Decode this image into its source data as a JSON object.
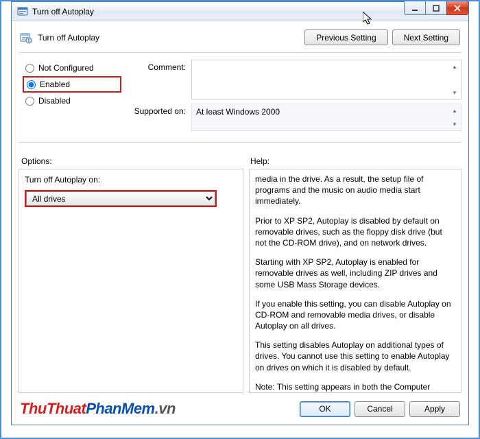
{
  "window": {
    "title": "Turn off Autoplay",
    "policy_title": "Turn off Autoplay"
  },
  "nav": {
    "prev": "Previous Setting",
    "next": "Next Setting"
  },
  "state": {
    "not_configured": "Not Configured",
    "enabled": "Enabled",
    "disabled": "Disabled",
    "selected": "enabled"
  },
  "meta": {
    "comment_label": "Comment:",
    "comment_value": "",
    "supported_label": "Supported on:",
    "supported_value": "At least Windows 2000"
  },
  "labels": {
    "options": "Options:",
    "help": "Help:"
  },
  "options_pane": {
    "field_label": "Turn off Autoplay on:",
    "selected_value": "All drives"
  },
  "help": {
    "p1": "media in the drive. As a result, the setup file of programs and the music on audio media start immediately.",
    "p2": "Prior to XP SP2, Autoplay is disabled by default on removable drives, such as the floppy disk drive (but not the CD-ROM drive), and on network drives.",
    "p3": "Starting with XP SP2, Autoplay is enabled for removable drives as well, including ZIP drives and some USB Mass Storage devices.",
    "p4": "If you enable this setting, you can disable Autoplay on CD-ROM and removable media drives, or disable Autoplay on all drives.",
    "p5": "This setting disables Autoplay on additional types of drives. You cannot use this setting to enable Autoplay on drives on which it is disabled by default.",
    "p6": "Note: This setting appears in both the Computer Configuration and User Configuration folders. If the settings conflict, the setting in Computer Configuration takes precedence over the setting in User Configuration."
  },
  "footer": {
    "ok": "OK",
    "cancel": "Cancel",
    "apply": "Apply"
  },
  "watermark": {
    "a": "ThuThuat",
    "b": "PhanMem",
    "c": ".vn"
  }
}
